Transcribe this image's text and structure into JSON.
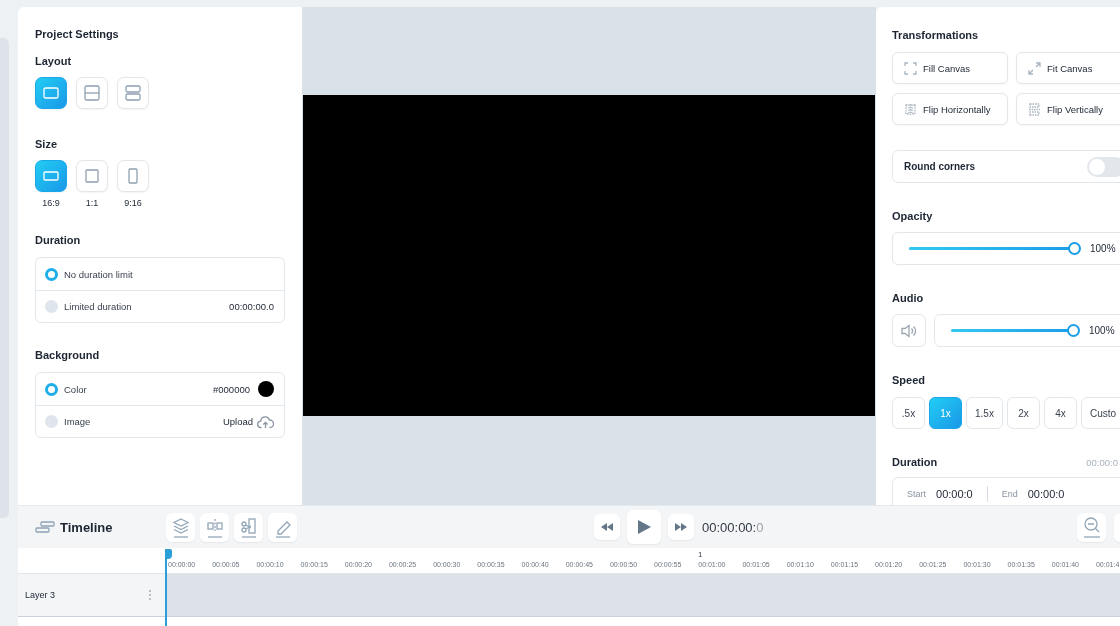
{
  "project_settings": {
    "title": "Project Settings",
    "layout": {
      "label": "Layout",
      "options": [
        {
          "kind": "single",
          "selected": true
        },
        {
          "kind": "split",
          "selected": false
        },
        {
          "kind": "stacked",
          "selected": false
        }
      ]
    },
    "size": {
      "label": "Size",
      "options": [
        {
          "kind": "wide",
          "label": "16:9",
          "selected": true
        },
        {
          "kind": "square",
          "label": "1:1",
          "selected": false
        },
        {
          "kind": "tall",
          "label": "9:16",
          "selected": false
        }
      ]
    },
    "duration": {
      "label": "Duration",
      "options": [
        {
          "label": "No duration limit",
          "selected": true
        },
        {
          "label": "Limited duration",
          "value": "00:00:00.0",
          "selected": false
        }
      ]
    },
    "background": {
      "label": "Background",
      "options": [
        {
          "kind": "color",
          "label": "Color",
          "value": "#000000",
          "color": "#000000",
          "selected": true
        },
        {
          "kind": "image",
          "label": "Image",
          "action": "Upload",
          "selected": false
        }
      ]
    }
  },
  "transformations": {
    "title": "Transformations",
    "buttons": [
      {
        "kind": "fill",
        "label": "Fill Canvas"
      },
      {
        "kind": "fit",
        "label": "Fit Canvas"
      },
      {
        "kind": "flip-h",
        "label": "Flip Horizontally"
      },
      {
        "kind": "flip-v",
        "label": "Flip Vertically"
      }
    ]
  },
  "round_corners": {
    "label": "Round corners",
    "on": false
  },
  "opacity": {
    "label": "Opacity",
    "level": 1,
    "reading": "100%"
  },
  "audio": {
    "label": "Audio",
    "level": 1,
    "reading": "100%"
  },
  "speed": {
    "label": "Speed",
    "options": [
      {
        "label": ".5x",
        "selected": false
      },
      {
        "label": "1x",
        "selected": true
      },
      {
        "label": "1.5x",
        "selected": false
      },
      {
        "label": "2x",
        "selected": false
      },
      {
        "label": "4x",
        "selected": false
      },
      {
        "label": "Custo",
        "selected": false
      }
    ]
  },
  "clip_duration": {
    "label": "Duration",
    "value": "00:00:0",
    "start_label": "Start",
    "start": "00:00:0",
    "end_label": "End",
    "end": "00:00:0"
  },
  "timeline": {
    "title": "Timeline",
    "time": "00:00:00:",
    "frame": "0"
  },
  "ruler": {
    "ticks": [
      {
        "label": "00:00:00"
      },
      {
        "label": "00:00:05"
      },
      {
        "label": "00:00:10"
      },
      {
        "label": "00:00:15"
      },
      {
        "label": "00:00:20"
      },
      {
        "label": "00:00:25"
      },
      {
        "label": "00:00:30"
      },
      {
        "label": "00:00:35"
      },
      {
        "label": "00:00:40"
      },
      {
        "label": "00:00:45"
      },
      {
        "label": "00:00:50"
      },
      {
        "label": "00:00:55"
      },
      {
        "label": "00:01:00",
        "marker": "1"
      },
      {
        "label": "00:01:05"
      },
      {
        "label": "00:01:10"
      },
      {
        "label": "00:01:15"
      },
      {
        "label": "00:01:20"
      },
      {
        "label": "00:01:25"
      },
      {
        "label": "00:01:30"
      },
      {
        "label": "00:01:35"
      },
      {
        "label": "00:01:40"
      },
      {
        "label": "00:01:4"
      }
    ]
  },
  "layers": [
    {
      "name": "Layer 3"
    }
  ]
}
